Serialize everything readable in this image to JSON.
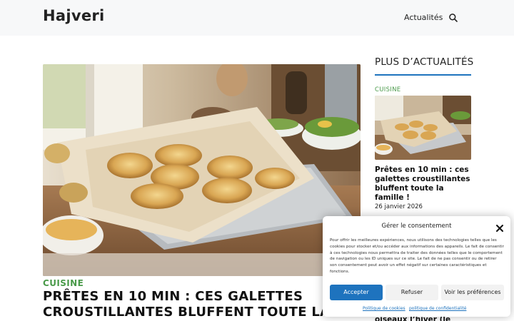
{
  "site": {
    "logo": "Hajveri",
    "nav": {
      "item": "Actualités"
    }
  },
  "main": {
    "category": "CUISINE",
    "title": "PRÊTES EN 10 MIN : CES GALETTES CROUSTILLANTES BLUFFENT TOUTE LA"
  },
  "sidebar": {
    "heading": "PLUS D’ACTUALITÉS",
    "item1": {
      "category": "CUISINE",
      "title": "Prêtes en 10 min : ces galettes croustillantes bluffent toute la famille !",
      "date": "26 janvier 2026"
    },
    "item2": {
      "title_partial": "oiseaux l’hiver (le"
    }
  },
  "consent": {
    "title": "Gérer le consentement",
    "body": "Pour offrir les meilleures expériences, nous utilisons des technologies telles que les cookies pour stocker et/ou accéder aux informations des appareils. Le fait de consentir à ces technologies nous permettra de traiter des données telles que le comportement de navigation ou les ID uniques sur ce site. Le fait de ne pas consentir ou de retirer son consentement peut avoir un effet négatif sur certaines caractéristiques et fonctions.",
    "accept_label": "Accepter",
    "refuse_label": "Refuser",
    "prefs_label": "Voir les préférences",
    "cookie_policy_link": "Politique de cookies",
    "privacy_link": "politique de confidentialité"
  },
  "icons": {
    "search": "search-icon",
    "close": "close-icon"
  },
  "colors": {
    "accent": "#1e73be",
    "category": "#4a9a4a",
    "header_bg": "#f7f8f9"
  }
}
